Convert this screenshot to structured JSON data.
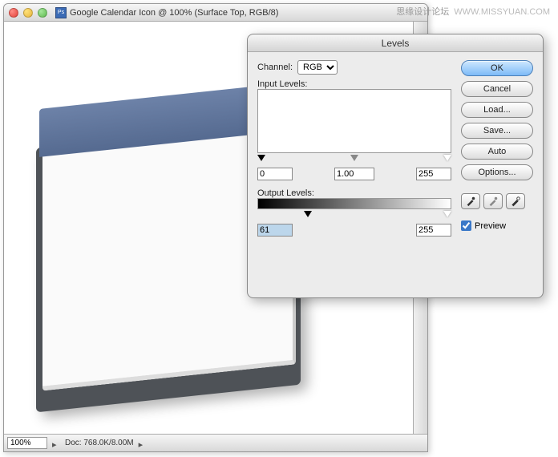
{
  "watermark": {
    "cn": "思缘设计论坛",
    "en": "WWW.MISSYUAN.COM"
  },
  "window": {
    "title": "Google Calendar Icon @ 100% (Surface Top, RGB/8)",
    "zoom": "100%",
    "doc": "Doc: 768.0K/8.00M"
  },
  "dialog": {
    "title": "Levels",
    "channel_label": "Channel:",
    "channel_value": "RGB",
    "input_label": "Input Levels:",
    "input": {
      "black": "0",
      "mid": "1.00",
      "white": "255"
    },
    "output_label": "Output Levels:",
    "output": {
      "black": "61",
      "white": "255"
    },
    "buttons": {
      "ok": "OK",
      "cancel": "Cancel",
      "load": "Load...",
      "save": "Save...",
      "auto": "Auto",
      "options": "Options..."
    },
    "preview_label": "Preview"
  }
}
